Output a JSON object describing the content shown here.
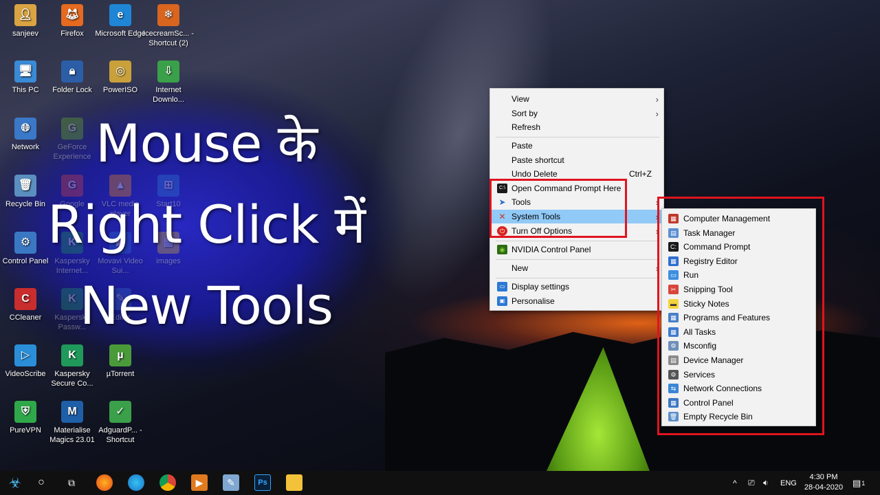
{
  "overlay_title": {
    "line1": "Mouse के",
    "line2": "Right Click में",
    "line3": "New Tools"
  },
  "desktop_icons": [
    {
      "label": "sanjeev",
      "icon": "user-folder-icon"
    },
    {
      "label": "Firefox",
      "icon": "firefox-icon"
    },
    {
      "label": "Microsoft Edge",
      "icon": "edge-icon"
    },
    {
      "label": "IcecreamSc... - Shortcut (2)",
      "icon": "icecream-icon"
    },
    {
      "label": "This PC",
      "icon": "this-pc-icon"
    },
    {
      "label": "Folder Lock",
      "icon": "folder-lock-icon"
    },
    {
      "label": "PowerISO",
      "icon": "poweriso-icon"
    },
    {
      "label": "Internet Downlo...",
      "icon": "idm-icon"
    },
    {
      "label": "Network",
      "icon": "network-icon"
    },
    {
      "label": "GeForce Experience",
      "icon": "geforce-icon"
    },
    {
      "label": "Recycle Bin",
      "icon": "recycle-bin-icon"
    },
    {
      "label": "Google",
      "icon": "google-icon"
    },
    {
      "label": "VLC media player",
      "icon": "vlc-icon"
    },
    {
      "label": "Start10",
      "icon": "start10-icon"
    },
    {
      "label": "Control Panel",
      "icon": "control-panel-icon"
    },
    {
      "label": "Kaspersky Internet...",
      "icon": "kaspersky-icon"
    },
    {
      "label": "Movavi Video Sui...",
      "icon": "movavi-icon"
    },
    {
      "label": "images",
      "icon": "folder-icon"
    },
    {
      "label": "CCleaner",
      "icon": "ccleaner-icon"
    },
    {
      "label": "Kaspersky Passw...",
      "icon": "kaspersky-password-icon"
    },
    {
      "label": "Editor",
      "icon": "editor-icon"
    },
    {
      "label": "VideoScribe",
      "icon": "videoscribe-icon"
    },
    {
      "label": "Kaspersky Secure Co...",
      "icon": "kaspersky-secure-icon"
    },
    {
      "label": "µTorrent",
      "icon": "utorrent-icon"
    },
    {
      "label": "PureVPN",
      "icon": "purevpn-icon"
    },
    {
      "label": "Materialise Magics 23.01",
      "icon": "materialise-icon"
    },
    {
      "label": "AdguardP... - Shortcut",
      "icon": "adguard-icon"
    }
  ],
  "context_menu": {
    "view": "View",
    "sort_by": "Sort by",
    "refresh": "Refresh",
    "paste": "Paste",
    "paste_shortcut": "Paste shortcut",
    "undo_delete": "Undo Delete",
    "undo_shortcut": "Ctrl+Z",
    "open_cmd": "Open Command Prompt Here",
    "tools": "Tools",
    "system_tools": "System Tools",
    "turn_off": "Turn Off Options",
    "nvidia": "NVIDIA Control Panel",
    "new": "New",
    "display_settings": "Display settings",
    "personalise": "Personalise"
  },
  "system_tools_submenu": [
    {
      "label": "Computer Management",
      "icon": "computer-management-icon",
      "color": "#c0392b"
    },
    {
      "label": "Task Manager",
      "icon": "task-manager-icon",
      "color": "#5b8fd1"
    },
    {
      "label": "Command Prompt",
      "icon": "command-prompt-icon",
      "color": "#1a1a1a"
    },
    {
      "label": "Registry Editor",
      "icon": "registry-editor-icon",
      "color": "#2e6fcf"
    },
    {
      "label": "Run",
      "icon": "run-icon",
      "color": "#3d8fe0"
    },
    {
      "label": "Snipping Tool",
      "icon": "snipping-tool-icon",
      "color": "#d8453a"
    },
    {
      "label": "Sticky Notes",
      "icon": "sticky-notes-icon",
      "color": "#f3d33c"
    },
    {
      "label": "Programs and Features",
      "icon": "programs-features-icon",
      "color": "#4a7fc8"
    },
    {
      "label": "All Tasks",
      "icon": "all-tasks-icon",
      "color": "#3f7bd0"
    },
    {
      "label": "Msconfig",
      "icon": "msconfig-icon",
      "color": "#6d8fb8"
    },
    {
      "label": "Device Manager",
      "icon": "device-manager-icon",
      "color": "#8a8a8a"
    },
    {
      "label": "Services",
      "icon": "services-icon",
      "color": "#555555"
    },
    {
      "label": "Network Connections",
      "icon": "network-connections-icon",
      "color": "#3a86d6"
    },
    {
      "label": "Control Panel",
      "icon": "control-panel-icon",
      "color": "#3b78c4"
    },
    {
      "label": "Empty Recycle Bin",
      "icon": "recycle-bin-icon",
      "color": "#5c8fc9"
    }
  ],
  "taskbar": {
    "language": "ENG",
    "time": "4:30 PM",
    "date": "28-04-2020",
    "notification_count": "1"
  },
  "colors": {
    "highlight_box": "#e0141e",
    "menu_hover": "#91c9f7",
    "taskbar_bg": "#101010"
  }
}
